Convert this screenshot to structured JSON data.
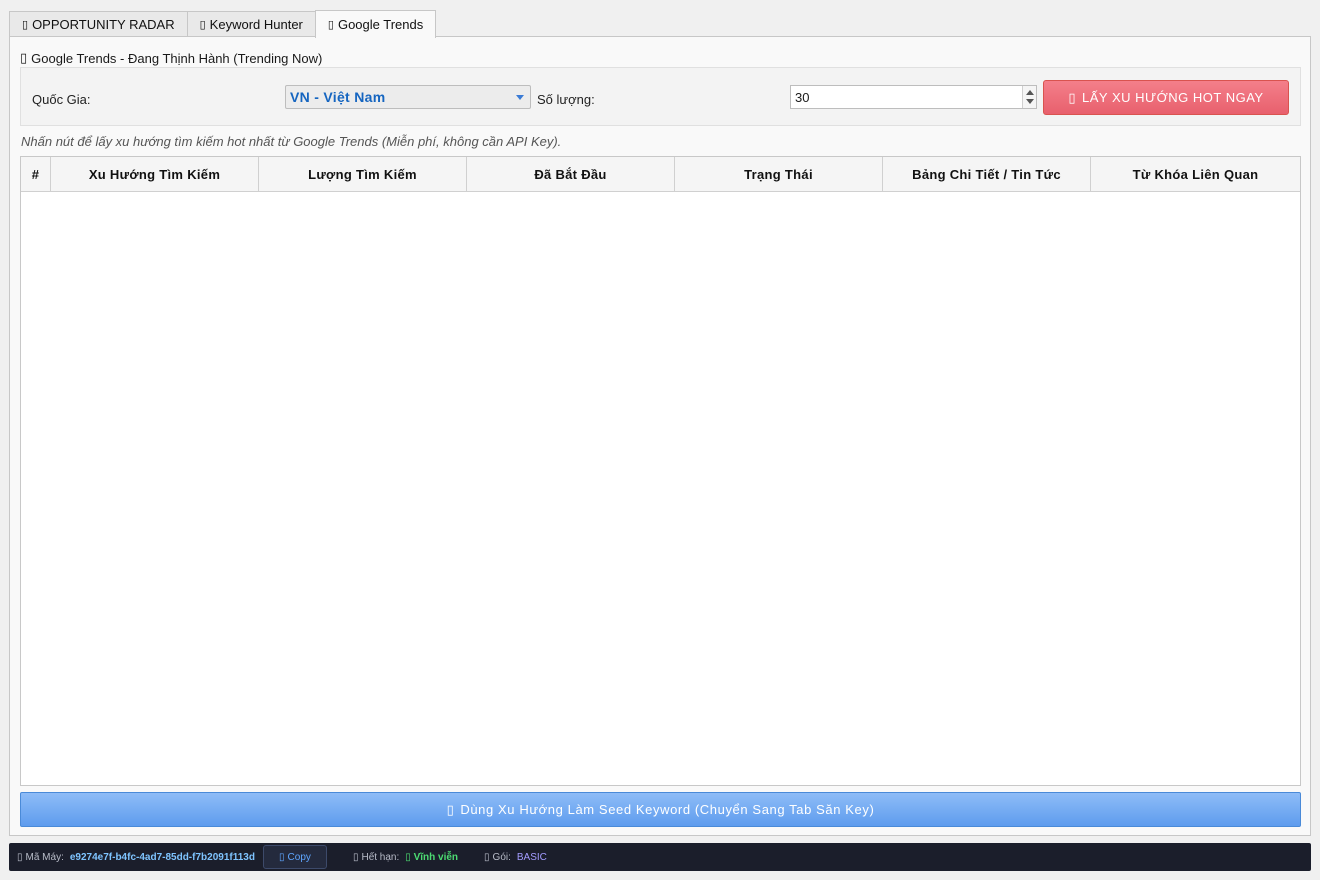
{
  "tabs": [
    {
      "icon": "▯",
      "label": "OPPORTUNITY RADAR"
    },
    {
      "icon": "▯",
      "label": "Keyword Hunter"
    },
    {
      "icon": "▯",
      "label": "Google Trends"
    }
  ],
  "section": {
    "icon": "▯",
    "title": "Google Trends - Đang Thịnh Hành (Trending Now)"
  },
  "controls": {
    "country_label": "Quốc Gia:",
    "country_value": "VN - Việt Nam",
    "count_label": "Số lượng:",
    "count_value": "30",
    "fetch_icon": "▯",
    "fetch_label": "LẤY XU HƯỚNG HOT NGAY"
  },
  "hint": "Nhấn nút để lấy xu hướng tìm kiếm hot nhất từ Google Trends (Miễn phí, không cần API Key).",
  "table": {
    "headers": [
      "#",
      "Xu Hướng Tìm Kiếm",
      "Lượng Tìm Kiếm",
      "Đã Bắt Đầu",
      "Trạng Thái",
      "Bảng Chi Tiết / Tin Tức",
      "Từ Khóa Liên Quan"
    ],
    "rows": []
  },
  "seed_button": {
    "icon": "▯",
    "label": "Dùng Xu Hướng Làm Seed Keyword (Chuyển Sang Tab Săn Key)"
  },
  "status": {
    "machine_icon": "▯",
    "machine_label": "Mã Máy:",
    "machine_id": "e9274e7f-b4fc-4ad7-85dd-f7b2091f113d",
    "copy_icon": "▯",
    "copy_label": "Copy",
    "expiry_icon": "▯",
    "expiry_label": "Hết hạn:",
    "expiry_value_icon": "▯",
    "expiry_value": "Vĩnh viễn",
    "plan_icon": "▯",
    "plan_label": "Gói:",
    "plan_value": "BASIC"
  },
  "colors": {
    "accent_blue": "#1565c0",
    "hot_button": "#e8606d",
    "seed_button": "#5e9cee",
    "status_bg": "#1b1e2b",
    "expiry_green": "#4cdc72",
    "plan_purple": "#a39cff"
  }
}
